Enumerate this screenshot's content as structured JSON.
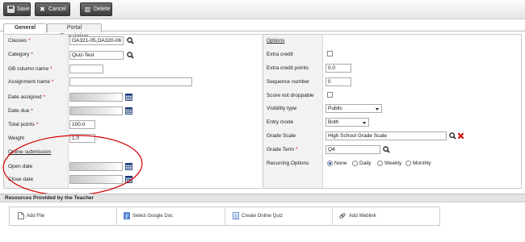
{
  "toolbar": {
    "save_label": "Save",
    "cancel_label": "Cancel",
    "delete_label": "Delete"
  },
  "tabs": [
    {
      "label": "General",
      "active": true
    },
    {
      "label": "Portal Description",
      "active": false
    }
  ],
  "left": {
    "classes": {
      "label": "Classes",
      "value": "OA321-05,OA320-06"
    },
    "category": {
      "label": "Category",
      "value": "Quiz-Test"
    },
    "gb_column_name": {
      "label": "GB column name",
      "value": ""
    },
    "assignment_name": {
      "label": "Assignment name",
      "value": ""
    },
    "date_assigned": {
      "label": "Date assigned"
    },
    "date_due": {
      "label": "Date due"
    },
    "total_points": {
      "label": "Total points",
      "value": "100.0"
    },
    "weight": {
      "label": "Weight",
      "value": "1.0"
    },
    "online_submission_title": "Online submission",
    "open_date": {
      "label": "Open date"
    },
    "close_date": {
      "label": "Close date"
    }
  },
  "right": {
    "options_title": "Options",
    "extra_credit": {
      "label": "Extra credit",
      "checked": false
    },
    "extra_credit_points": {
      "label": "Extra credit points",
      "value": "0.0"
    },
    "sequence_number": {
      "label": "Sequence number",
      "value": "0"
    },
    "score_not_droppable": {
      "label": "Score not droppable",
      "checked": false
    },
    "visibility_type": {
      "label": "Visibility type",
      "value": "Public"
    },
    "entry_mode": {
      "label": "Entry mode",
      "value": "Both"
    },
    "grade_scale": {
      "label": "Grade Scale",
      "value": "High School Grade Scale"
    },
    "grade_term": {
      "label": "Grade Term",
      "value": "Q4"
    },
    "recurring_options": {
      "label": "Recurring Options",
      "options": [
        "None",
        "Daily",
        "Weekly",
        "Monthly"
      ],
      "selected": "None"
    }
  },
  "resources": {
    "title": "Resources Provided by the Teacher",
    "items": [
      "Add File",
      "Select Google Doc",
      "Create Online Quiz",
      "Add Weblink"
    ]
  },
  "colors": {
    "required": "#cc0000",
    "annotation_ellipse": "#d40000",
    "accent": "#1f5fbf"
  }
}
